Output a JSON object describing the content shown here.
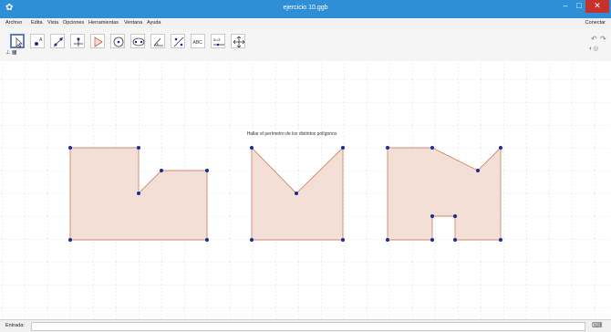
{
  "window": {
    "title": "ejercicio 10.ggb",
    "minimize_icon": "minimize-icon",
    "maximize_icon": "maximize-icon",
    "close_icon": "close-icon"
  },
  "menu": {
    "items": [
      "Archivo",
      "Edita",
      "Vista",
      "Opciones",
      "Herramientas",
      "Ventana",
      "Ayuda"
    ],
    "connect_label": "Conectar"
  },
  "toolbar": {
    "tools": [
      {
        "name": "move-tool-icon"
      },
      {
        "name": "point-tool-icon"
      },
      {
        "name": "line-tool-icon"
      },
      {
        "name": "perpendicular-tool-icon"
      },
      {
        "name": "polygon-tool-icon"
      },
      {
        "name": "circle-tool-icon"
      },
      {
        "name": "ellipse-tool-icon"
      },
      {
        "name": "angle-tool-icon"
      },
      {
        "name": "reflect-tool-icon"
      },
      {
        "name": "text-tool-icon",
        "label": "ABC"
      },
      {
        "name": "slider-tool-icon",
        "label": "a=2"
      },
      {
        "name": "move-view-tool-icon"
      }
    ],
    "undo_icon": "undo-icon",
    "redo_icon": "redo-icon",
    "help_icons": "help-icons"
  },
  "graphics": {
    "instruction": "Hallar el perímetro de los distintos polígonos",
    "grid": true,
    "accent_fill": "#f3dfd6",
    "accent_stroke": "#c98a70",
    "point_color": "#1a2a9a"
  },
  "input_bar": {
    "label": "Entrada:",
    "value": "",
    "keyboard_icon": "keyboard-icon"
  }
}
